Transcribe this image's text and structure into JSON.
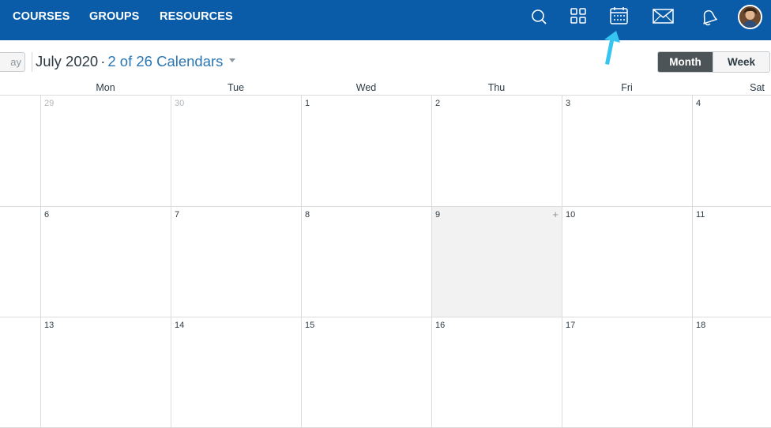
{
  "nav": {
    "links": [
      "COURSES",
      "GROUPS",
      "RESOURCES"
    ],
    "icons": [
      "search-icon",
      "dashboard-grid-icon",
      "calendar-icon",
      "inbox-mail-icon",
      "notifications-bell-icon"
    ],
    "brand_color": "#0a5ca8"
  },
  "toolbar": {
    "today_label": "ay",
    "month_year": "July 2020",
    "separator": "·",
    "calendars_label": "2 of 26 Calendars",
    "views": {
      "month": "Month",
      "week": "Week"
    },
    "active_view": "Month"
  },
  "calendar": {
    "days_of_week": [
      "Mon",
      "Tue",
      "Wed",
      "Thu",
      "Fri",
      "Sat"
    ],
    "weeks": [
      [
        "29",
        "30",
        "1",
        "2",
        "3",
        "4"
      ],
      [
        "6",
        "7",
        "8",
        "9",
        "10",
        "11"
      ],
      [
        "13",
        "14",
        "15",
        "16",
        "17",
        "18"
      ]
    ],
    "today_label": "9",
    "add_event_symbol": "+"
  },
  "annotation": {
    "arrow_color": "#36c5f0",
    "points_to": "calendar-icon"
  }
}
